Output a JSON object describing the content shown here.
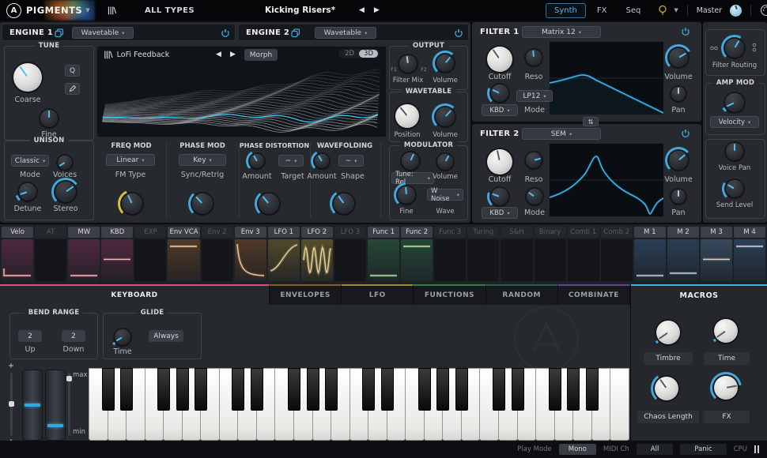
{
  "topbar": {
    "brand": "PIGMENTS",
    "logo": "A",
    "list_icon": "|||\\",
    "library": "ALL TYPES",
    "preset": "Kicking Risers*",
    "tabs": [
      {
        "label": "Synth"
      },
      {
        "label": "FX"
      },
      {
        "label": "Seq"
      }
    ],
    "master_label": "Master"
  },
  "engine1": {
    "title": "ENGINE 1",
    "type": "Wavetable",
    "tune": {
      "title": "TUNE",
      "coarse": "Coarse",
      "fine": "Fine",
      "quantize": "Q"
    },
    "unison": {
      "title": "UNISON",
      "mode_value": "Classic",
      "mode": "Mode",
      "voices": "Voices",
      "detune": "Detune",
      "stereo": "Stereo"
    },
    "viewer": {
      "icon": "|||\\",
      "name": "LoFi Feedback",
      "morph": "Morph",
      "view2d": "2D",
      "view3d": "3D"
    },
    "freq_mod": {
      "title": "FREQ MOD",
      "value": "Linear",
      "label": "FM Type"
    },
    "phase_mod": {
      "title": "PHASE MOD",
      "value": "Key",
      "label": "Sync/Retrig"
    },
    "phase_distortion": {
      "title": "PHASE DISTORTION",
      "amount": "Amount",
      "target": "Target",
      "target_value": "~"
    },
    "wavefolding": {
      "title": "WAVEFOLDING",
      "amount": "Amount",
      "shape": "Shape",
      "shape_value": "~"
    }
  },
  "engine2": {
    "title": "ENGINE 2",
    "type": "Wavetable"
  },
  "output": {
    "title": "OUTPUT",
    "filter_mix": "Filter Mix",
    "f1": "F1",
    "f2": "F2",
    "volume": "Volume"
  },
  "wavetable": {
    "title": "WAVETABLE",
    "position": "Position",
    "volume": "Volume"
  },
  "modulator": {
    "title": "MODULATOR",
    "tune_value": "Tune: Rel",
    "volume": "Volume",
    "fine": "Fine",
    "wave_value": "W Noise",
    "wave": "Wave"
  },
  "filter1": {
    "title": "FILTER 1",
    "type": "Matrix 12",
    "cutoff": "Cutoff",
    "reso": "Reso",
    "volume": "Volume",
    "pan": "Pan",
    "kbd": "KBD",
    "mode_value": "LP12",
    "mode": "Mode"
  },
  "filter2": {
    "title": "FILTER 2",
    "type": "SEM",
    "cutoff": "Cutoff",
    "reso": "Reso",
    "volume": "Volume",
    "pan": "Pan",
    "kbd": "KBD",
    "mode": "Mode"
  },
  "voice": {
    "filter_routing": "Filter Routing",
    "amp_mod": "AMP MOD",
    "amp_mod_value": "Velocity",
    "voice_pan": "Voice Pan",
    "send_level": "Send Level"
  },
  "mod_sources": [
    {
      "label": "Velo",
      "active": true,
      "color": "#c13a74",
      "shape": "step-bottom"
    },
    {
      "label": "AT",
      "active": false,
      "color": "#c13a74",
      "shape": "empty"
    },
    {
      "label": "MW",
      "active": true,
      "color": "#c13a74",
      "shape": "line-bottom"
    },
    {
      "label": "KBD",
      "active": true,
      "color": "#c13a74",
      "shape": "line-mid"
    },
    {
      "label": "EXP",
      "active": false,
      "color": "#c13a74",
      "shape": "empty"
    },
    {
      "label": "Env VCA",
      "active": true,
      "color": "#c7742f",
      "shape": "line-top"
    },
    {
      "label": "Env 2",
      "active": false,
      "color": "#c7742f",
      "shape": "empty"
    },
    {
      "label": "Env 3",
      "active": true,
      "color": "#c7742f",
      "shape": "decay"
    },
    {
      "label": "LFO 1",
      "active": true,
      "color": "#c2a636",
      "shape": "rise"
    },
    {
      "label": "LFO 2",
      "active": true,
      "color": "#d8bc40",
      "shape": "sine"
    },
    {
      "label": "LFO 3",
      "active": false,
      "color": "#c2a636",
      "shape": "empty"
    },
    {
      "label": "Func 1",
      "active": true,
      "color": "#37a35d",
      "shape": "line-bottom"
    },
    {
      "label": "Func 2",
      "active": true,
      "color": "#37a35d",
      "shape": "line-top"
    },
    {
      "label": "Func 3",
      "active": false,
      "color": "#37a35d",
      "shape": "empty"
    },
    {
      "label": "Turing",
      "active": false,
      "color": "#2f8e7b",
      "shape": "empty"
    },
    {
      "label": "S&H",
      "active": false,
      "color": "#2f8e7b",
      "shape": "empty"
    },
    {
      "label": "Binary",
      "active": false,
      "color": "#2f8e7b",
      "shape": "empty"
    },
    {
      "label": "Comb 1",
      "active": false,
      "color": "#3a9a9a",
      "shape": "empty"
    },
    {
      "label": "Comb 2",
      "active": false,
      "color": "#3a9a9a",
      "shape": "empty"
    },
    {
      "label": "M 1",
      "active": true,
      "color": "#4b86c8",
      "shape": "line-bottom"
    },
    {
      "label": "M 2",
      "active": true,
      "color": "#4b86c8",
      "shape": "line-low"
    },
    {
      "label": "M 3",
      "active": true,
      "color": "#6fa8dc",
      "shape": "line-mid"
    },
    {
      "label": "M 4",
      "active": true,
      "color": "#4b86c8",
      "shape": "line-top"
    }
  ],
  "bottom_tabs": [
    {
      "label": "KEYBOARD",
      "color": "#e14b86",
      "active": true
    },
    {
      "label": "ENVELOPES",
      "color": "#8d5a2c",
      "active": false
    },
    {
      "label": "LFO",
      "color": "#9c8a2e",
      "active": false
    },
    {
      "label": "FUNCTIONS",
      "color": "#2f7e46",
      "active": false
    },
    {
      "label": "RANDOM",
      "color": "#28604a",
      "active": false
    },
    {
      "label": "COMBINATE",
      "color": "#5e4399",
      "active": false
    }
  ],
  "keyboard_panel": {
    "bend_range": {
      "title": "BEND RANGE",
      "up_value": "2",
      "up": "Up",
      "down_value": "2",
      "down": "Down"
    },
    "glide": {
      "title": "GLIDE",
      "time": "Time",
      "always": "Always"
    },
    "wheels": {
      "max": "max",
      "min": "min",
      "plus": "+",
      "minus": "-"
    }
  },
  "macros": {
    "title": "MACROS",
    "knobs": [
      {
        "label": "Timbre"
      },
      {
        "label": "Time"
      },
      {
        "label": "Chaos Length"
      },
      {
        "label": "FX"
      }
    ]
  },
  "statusbar": {
    "play_mode": "Play Mode",
    "play_mode_value": "Mono",
    "midi_ch": "MIDI Ch",
    "midi_ch_value": "All",
    "panic": "Panic",
    "cpu": "CPU"
  }
}
